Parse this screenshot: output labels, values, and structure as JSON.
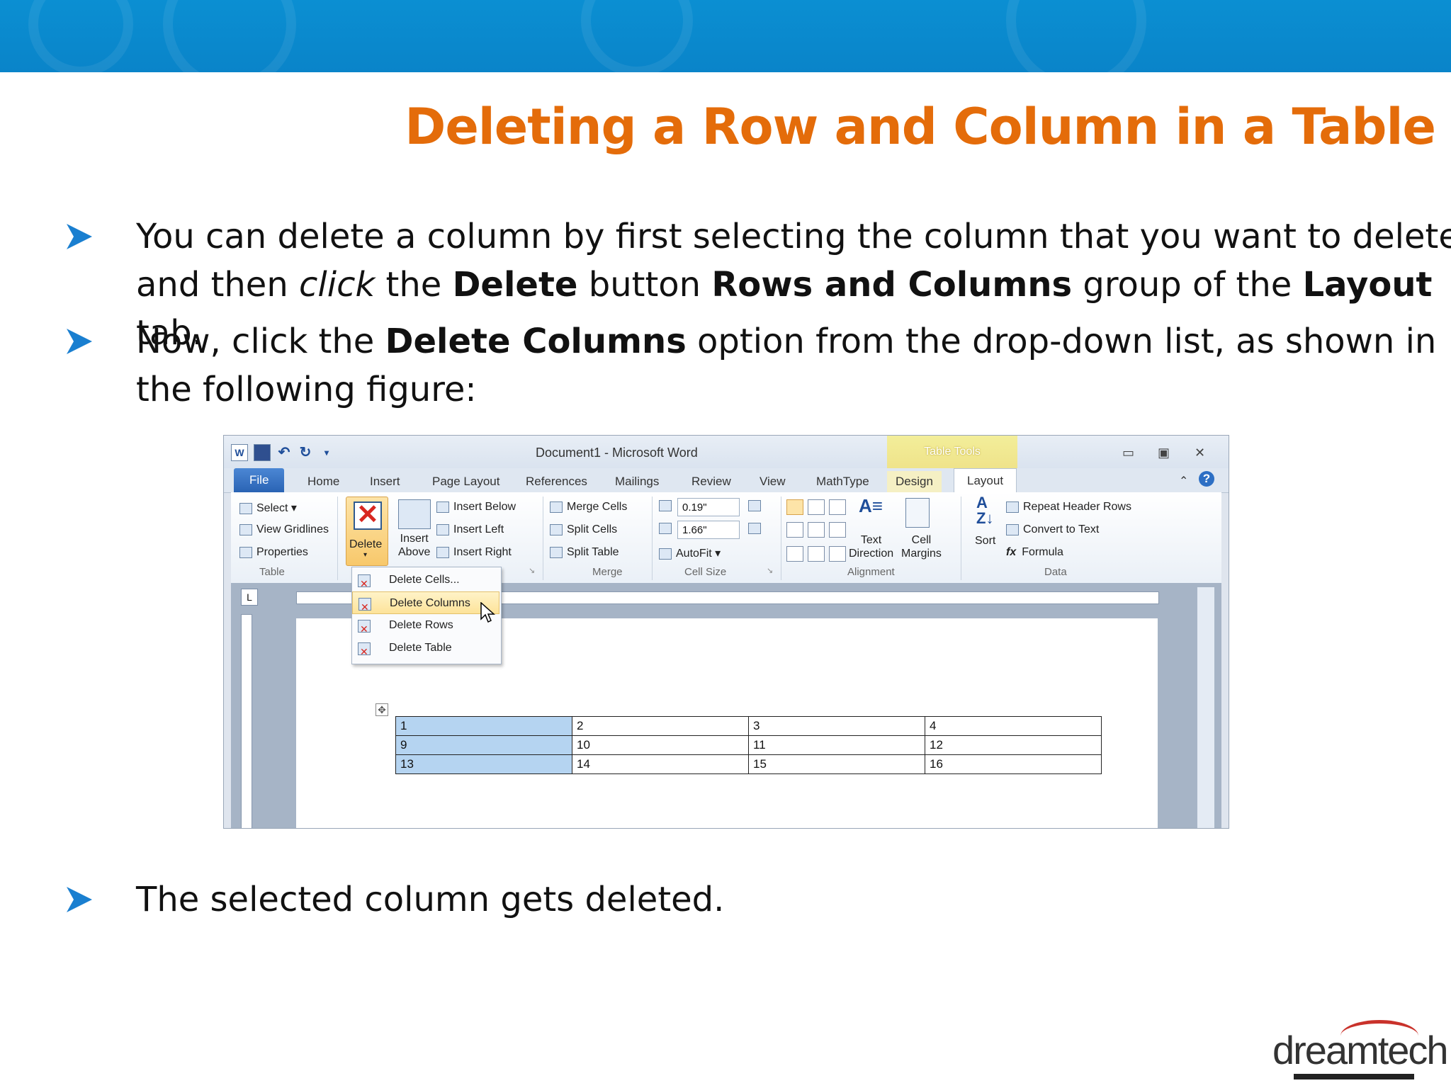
{
  "slide": {
    "title": "Deleting a Row and Column in a Table",
    "bullet1": {
      "p1": "You can delete a column by first selecting the column that you want to delete and then ",
      "click": "click",
      "p2": " the ",
      "b1": "Delete",
      "p3": " button ",
      "b2": "Rows and Columns",
      "p4": " group of the ",
      "b3": "Layout",
      "p5": " tab."
    },
    "bullet2": {
      "p1": "Now, click the ",
      "b1": "Delete Columns",
      "p2": " option from the drop-down list, as shown in the following figure:"
    },
    "bullet3": "The selected column gets deleted.",
    "logo": "dreamtech"
  },
  "word": {
    "window_title": "Document1  -  Microsoft Word",
    "table_tools": "Table Tools",
    "tabs": [
      "File",
      "Home",
      "Insert",
      "Page Layout",
      "References",
      "Mailings",
      "Review",
      "View",
      "MathType",
      "Design",
      "Layout"
    ],
    "ribbon": {
      "select": "Select ▾",
      "view_gridlines": "View Gridlines",
      "properties": "Properties",
      "group_table": "Table",
      "delete": "Delete",
      "insert_above_1": "Insert",
      "insert_above_2": "Above",
      "insert_below": "Insert Below",
      "insert_left": "Insert Left",
      "insert_right": "Insert Right",
      "merge_cells": "Merge Cells",
      "split_cells": "Split Cells",
      "split_table": "Split Table",
      "group_merge": "Merge",
      "height": "0.19\"",
      "width": "1.66\"",
      "autofit": "AutoFit ▾",
      "group_cellsize": "Cell Size",
      "text_direction_1": "Text",
      "text_direction_2": "Direction",
      "cell_margins_1": "Cell",
      "cell_margins_2": "Margins",
      "group_alignment": "Alignment",
      "sort": "Sort",
      "repeat_header": "Repeat Header Rows",
      "convert_text": "Convert to Text",
      "formula": "Formula",
      "group_data": "Data"
    },
    "menu": [
      "Delete Cells...",
      "Delete Columns",
      "Delete Rows",
      "Delete Table"
    ],
    "table_rows": [
      [
        "1",
        "2",
        "3",
        "4"
      ],
      [
        "9",
        "10",
        "11",
        "12"
      ],
      [
        "13",
        "14",
        "15",
        "16"
      ]
    ]
  }
}
